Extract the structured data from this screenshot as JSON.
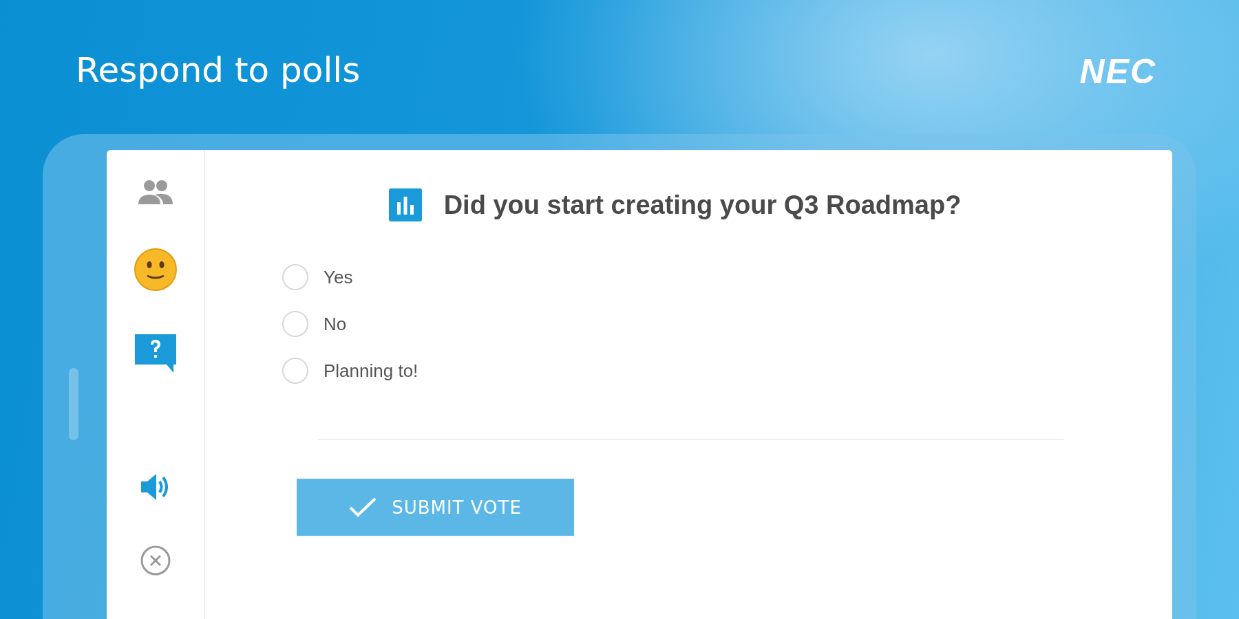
{
  "header": {
    "title": "Respond to polls",
    "logo": "NEC"
  },
  "sidebar": {
    "items": [
      {
        "kind": "people",
        "selected": false
      },
      {
        "kind": "emoji",
        "selected": false
      },
      {
        "kind": "question",
        "selected": true
      },
      {
        "kind": "speaker",
        "selected": false
      },
      {
        "kind": "close",
        "selected": false
      }
    ]
  },
  "poll": {
    "question": "Did you start creating your Q3 Roadmap?",
    "options": [
      {
        "label": "Yes",
        "selected": false
      },
      {
        "label": "No",
        "selected": false
      },
      {
        "label": "Planning to!",
        "selected": false
      }
    ],
    "submit": "SUBMIT VOTE"
  }
}
